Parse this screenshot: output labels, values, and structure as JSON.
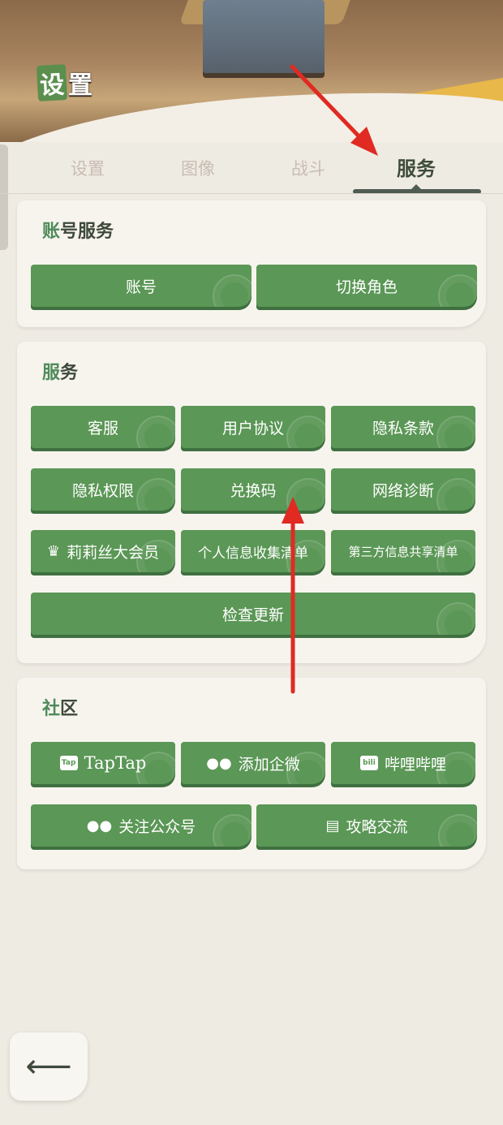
{
  "header": {
    "title_badge": "设",
    "title_rest": "置"
  },
  "tabs": [
    {
      "label": "设置",
      "active": false
    },
    {
      "label": "图像",
      "active": false
    },
    {
      "label": "战斗",
      "active": false
    },
    {
      "label": "服务",
      "active": true
    }
  ],
  "account_section": {
    "title_first": "账",
    "title_rest": "号服务",
    "buttons": [
      "账号",
      "切换角色"
    ]
  },
  "service_section": {
    "title_first": "服",
    "title_rest": "务",
    "buttons": [
      "客服",
      "用户协议",
      "隐私条款",
      "隐私权限",
      "兑换码",
      "网络诊断",
      "莉莉丝大会员",
      "个人信息收集清单",
      "第三方信息共享清单",
      "检查更新"
    ]
  },
  "community_section": {
    "title_first": "社",
    "title_rest": "区",
    "buttons": [
      "TapTap",
      "添加企微",
      "哔哩哔哩",
      "关注公众号",
      "攻略交流"
    ],
    "taptap_icon_text": "Tap",
    "bilibili_icon_text": "bili"
  },
  "icons": {
    "crown": "crown-icon",
    "taptap": "taptap-icon",
    "wechat": "wechat-icon",
    "bilibili": "bilibili-icon",
    "guide": "document-icon",
    "back": "back-arrow-icon"
  },
  "colors": {
    "button_green": "#5b9756",
    "accent_red": "#e02a22",
    "background": "#eeebe3"
  }
}
